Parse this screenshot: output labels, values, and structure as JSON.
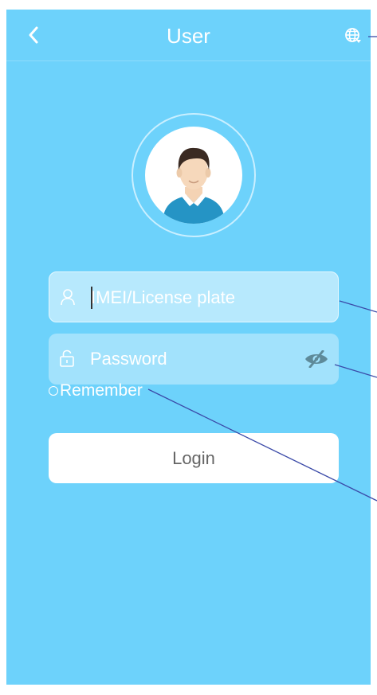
{
  "header": {
    "title": "User",
    "back_icon": "chevron-left-icon",
    "language_icon": "globe-icon"
  },
  "avatar": {
    "icon": "user-avatar-icon"
  },
  "form": {
    "account_placeholder": "IMEI/License plate",
    "account_value": "",
    "account_icon": "user-icon",
    "password_placeholder": "Password",
    "password_value": "",
    "password_icon": "lock-icon",
    "visibility_icon": "eye-off-icon",
    "remember_label": "Remember",
    "remember_checked": false,
    "login_label": "Login"
  },
  "colors": {
    "background": "#6dd2fb",
    "field_active": "#b7e9fd",
    "field": "#a2e2fc",
    "button": "#ffffff",
    "annotation_line": "#3b4aa8"
  }
}
